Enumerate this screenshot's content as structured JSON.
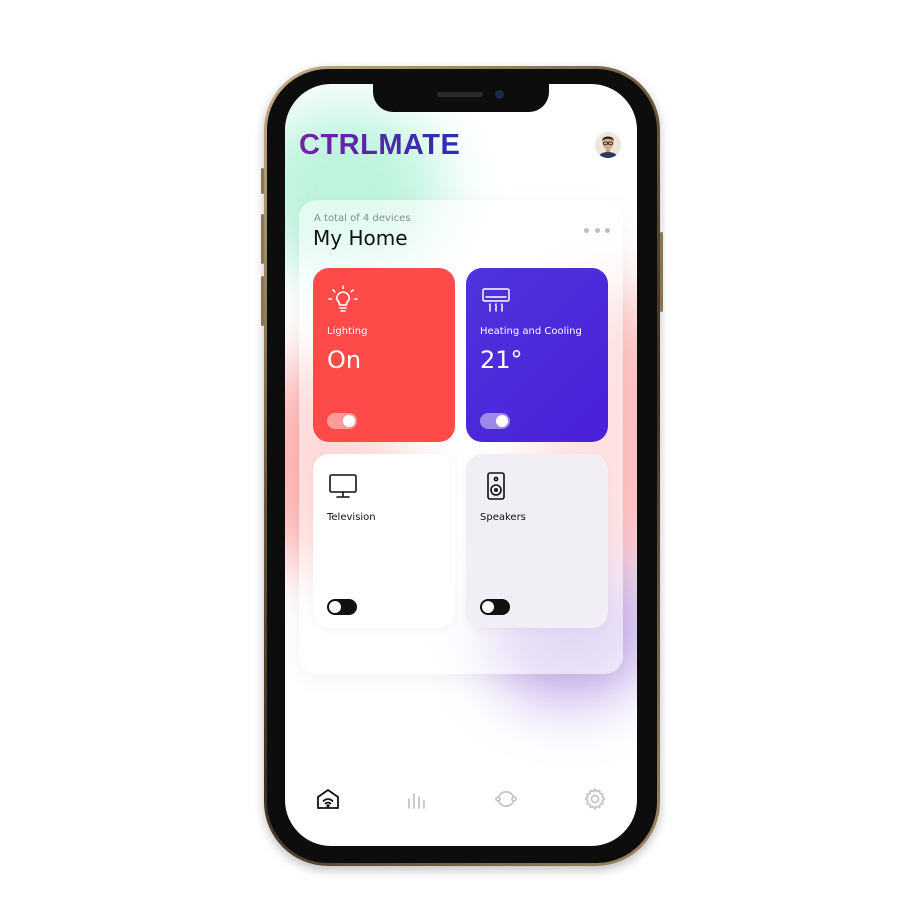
{
  "app": {
    "logo": "CTRLMATE"
  },
  "home": {
    "subtitle": "A total of 4 devices",
    "title": "My Home"
  },
  "devices": [
    {
      "name": "Lighting",
      "value": "On",
      "icon": "lightbulb-icon",
      "on": true,
      "color": "#ff4a4a"
    },
    {
      "name": "Heating and Cooling",
      "value": "21°",
      "icon": "air-conditioner-icon",
      "on": true,
      "color": "#4f34dc"
    },
    {
      "name": "Television",
      "value": "",
      "icon": "monitor-icon",
      "on": false,
      "color": "#ffffff"
    },
    {
      "name": "Speakers",
      "value": "",
      "icon": "speaker-icon",
      "on": false,
      "color": "#f2eef6"
    }
  ],
  "nav": [
    {
      "icon": "home-wifi-icon",
      "active": true
    },
    {
      "icon": "bar-chart-icon",
      "active": false
    },
    {
      "icon": "sync-icon",
      "active": false
    },
    {
      "icon": "gear-icon",
      "active": false
    }
  ],
  "colors": {
    "accent": "#4f34dc",
    "danger": "#ff4a4a",
    "logo_start": "#7a1fa8",
    "logo_end": "#2b2fb0"
  }
}
